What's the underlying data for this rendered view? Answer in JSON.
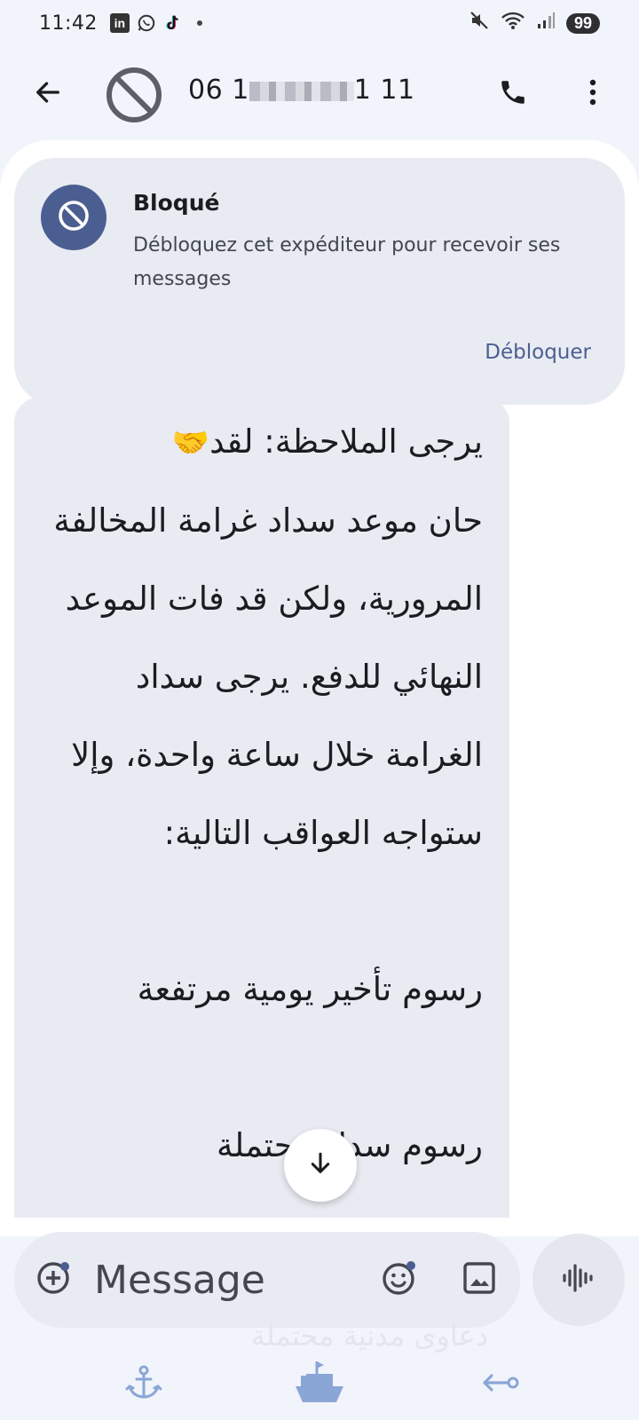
{
  "status_bar": {
    "time": "11:42",
    "app_icons": [
      "linkedin-icon",
      "whatsapp-icon",
      "tiktok-icon"
    ],
    "linkedin_label": "in",
    "battery": "99"
  },
  "header": {
    "contact_prefix": "06 1",
    "contact_suffix": "1 11",
    "icons": {
      "back": "arrow-left-icon",
      "avatar": "blocked-icon",
      "call": "phone-icon",
      "more": "more-vert-icon"
    }
  },
  "blocked_banner": {
    "title": "Bloqué",
    "description": "Débloquez cet expéditeur pour recevoir ses messages",
    "action": "Débloquer"
  },
  "message": {
    "line_1_text": "يرجى الملاحظة: لقد",
    "emoji": "🤝",
    "body_1": "حان موعد سداد غرامة المخالفة المرورية، ولكن قد فات الموعد النهائي للدفع. يرجى سداد الغرامة خلال ساعة واحدة، وإلا ستواجه العواقب التالية:",
    "item_1": "رسوم تأخير يومية مرتفعة",
    "item_2": "رسوم سداد محتملة",
    "faded_text": "دعاوى مدنية محتملة"
  },
  "composer": {
    "placeholder": "Message"
  },
  "colors": {
    "accent": "#4b5e91",
    "surface": "#e9ebf3",
    "background": "#f2f4fb"
  }
}
